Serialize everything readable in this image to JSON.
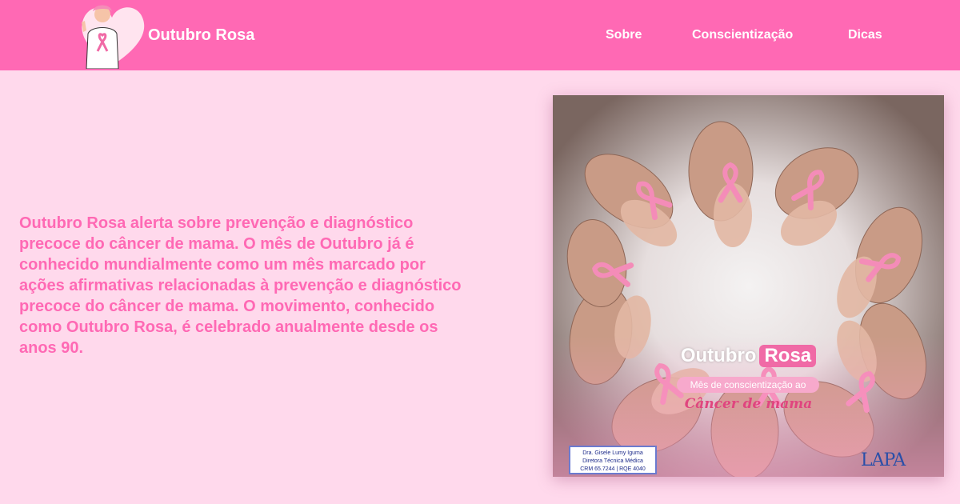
{
  "header": {
    "brand_title": "Outubro Rosa",
    "nav": [
      "Sobre",
      "Conscientização",
      "Dicas"
    ]
  },
  "main": {
    "intro_text": "Outubro Rosa alerta sobre prevenção e diagnóstico precoce do câncer de mama. O mês de Outubro já é conhecido mundialmente como um mês marcado por ações afirmativas relacionadas à prevenção e diagnóstico precoce do câncer de mama. O movimento, conhecido como Outubro Rosa, é celebrado anualmente desde os anos 90."
  },
  "poster": {
    "title_word1": "Outubro",
    "title_word2": "Rosa",
    "subtitle": "Mês de conscientização ao",
    "tagline": "Câncer de mama",
    "credit_line1": "Dra. Gisele Lumy Iguma",
    "credit_line2": "Diretora Técnica Médica",
    "credit_line3": "CRM 65.7244 | RQE 4040",
    "brand_mark": "LAPA"
  },
  "colors": {
    "nav_bg": "#ff69b4",
    "page_bg": "#ffd9ec",
    "accent_text": "#ff69b4",
    "ribbon": "#f48cb8"
  },
  "icons": {
    "logo": "awareness-illustration",
    "ribbon": "pink-ribbon"
  }
}
